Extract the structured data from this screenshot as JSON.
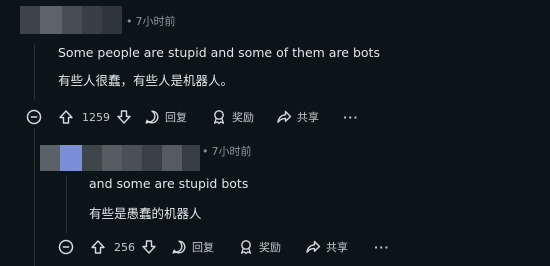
{
  "comments": [
    {
      "time": "7小时前",
      "text_en": "Some people are stupid and some of them are bots",
      "text_zh": "有些人很蠢，有些人是机器人。",
      "votes": "1259",
      "reply_label": "回复",
      "award_label": "奖励",
      "share_label": "共享",
      "more_label": "···"
    },
    {
      "time": "7小时前",
      "text_en": "and some are stupid bots",
      "text_zh": "有些是愚蠢的机器人",
      "votes": "256",
      "reply_label": "回复",
      "award_label": "奖励",
      "share_label": "共享",
      "more_label": "···"
    }
  ],
  "icons": {
    "collapse": "collapse-icon",
    "upvote": "upvote-icon",
    "downvote": "downvote-icon",
    "reply": "comment-bubble-icon",
    "award": "award-icon",
    "share": "share-icon",
    "more": "more-icon"
  },
  "colors": {
    "background": "#0b1416",
    "text": "#e3e6e8",
    "muted": "#8a9499",
    "thread_line": "#2a3236"
  }
}
